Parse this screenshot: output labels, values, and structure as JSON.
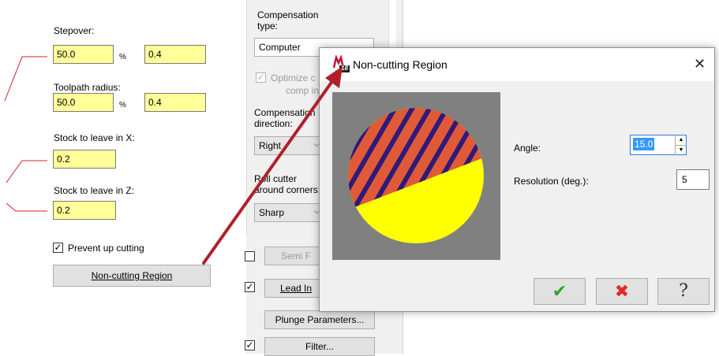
{
  "left_panel": {
    "stepover_label": "Stepover:",
    "stepover_value": "50.0",
    "stepover_unit": "%",
    "stepover_abs": "0.4",
    "toolpath_radius_label": "Toolpath radius:",
    "toolpath_radius_value": "50.0",
    "toolpath_radius_unit": "%",
    "toolpath_radius_abs": "0.4",
    "stock_x_label": "Stock to leave in X:",
    "stock_x_value": "0.2",
    "stock_z_label": "Stock to leave in Z:",
    "stock_z_value": "0.2",
    "prevent_up_cutting_label": "Prevent up cutting",
    "prevent_up_cutting_checked": true,
    "non_cutting_button": "Non-cutting Region"
  },
  "middle_panel": {
    "comp_type_label": "Compensation type:",
    "comp_type_value": "Computer",
    "optimize_label": "Optimize c",
    "optimize_label2": "comp in",
    "comp_direction_label": "Compensation direction:",
    "comp_direction_value": "Right",
    "roll_cutter_label": "Roll cutter around corners:",
    "roll_cutter_value": "Sharp",
    "semi_finish_button": "Semi F",
    "lead_in_button": "Lead In",
    "plunge_button": "Plunge Parameters...",
    "filter_button": "Filter..."
  },
  "dialog": {
    "title": "Non-cutting Region",
    "app_badge": "18",
    "close_glyph": "✕",
    "angle_label": "Angle:",
    "angle_value": "15.0",
    "resolution_label": "Resolution (deg.):",
    "resolution_value": "5",
    "ok_glyph": "✔",
    "cancel_glyph": "✖",
    "help_glyph": "?"
  },
  "colors": {
    "field_yellow": "#ffff99",
    "preview_bg": "#808080",
    "hatch_orange": "#e05a37",
    "hatch_purple": "#2e1a7a",
    "region_yellow": "#ffff00",
    "arrow_red": "#b0202a",
    "ok_green": "#2fa12f",
    "cancel_red": "#e22a2a"
  },
  "icons": {
    "app_icon": "mastercam-logo-icon",
    "ok_icon": "checkmark-icon",
    "cancel_icon": "red-x-icon",
    "help_icon": "question-mark-icon"
  }
}
